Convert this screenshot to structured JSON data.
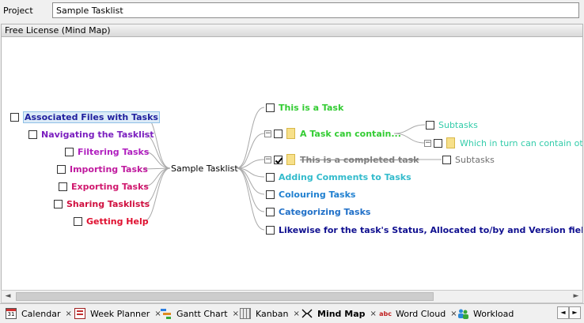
{
  "project": {
    "label": "Project",
    "value": "Sample Tasklist"
  },
  "panel": {
    "title": "Free License (Mind Map)"
  },
  "mindmap": {
    "root": {
      "label": "Sample Tasklist",
      "color": "#000000"
    },
    "left": [
      {
        "label": "Associated Files with Tasks",
        "color": "#1f1f9e",
        "selected": true
      },
      {
        "label": "Navigating the Tasklist",
        "color": "#7b1fbf"
      },
      {
        "label": "Filtering Tasks",
        "color": "#b01fbf"
      },
      {
        "label": "Importing Tasks",
        "color": "#c01a9e"
      },
      {
        "label": "Exporting Tasks",
        "color": "#d0186e"
      },
      {
        "label": "Sharing Tasklists",
        "color": "#d01040"
      },
      {
        "label": "Getting Help",
        "color": "#e01030"
      }
    ],
    "right": [
      {
        "label": "This is a Task",
        "color": "#33cc33"
      },
      {
        "label": "A Task can contain...",
        "color": "#33cc33"
      },
      {
        "label": "This is a completed task",
        "color": "#808080",
        "completed": true
      },
      {
        "label": "Adding Comments to Tasks",
        "color": "#33bbcc"
      },
      {
        "label": "Colouring Tasks",
        "color": "#2080d0"
      },
      {
        "label": "Categorizing Tasks",
        "color": "#2070c8"
      },
      {
        "label": "Likewise for the task's Status, Allocated to/by and Version fields",
        "color": "#101090"
      }
    ],
    "sub": {
      "subtasks_a": {
        "label": "Subtasks",
        "color": "#33ccaa"
      },
      "nested": {
        "label": "Which in turn can contain othe",
        "color": "#33ccaa"
      },
      "subtasks_b": {
        "label": "Subtasks",
        "color": "#707070"
      }
    }
  },
  "tabs": [
    {
      "label": "Calendar",
      "icon": "calendar-icon"
    },
    {
      "label": "Week Planner",
      "icon": "week-planner-icon"
    },
    {
      "label": "Gantt Chart",
      "icon": "gantt-chart-icon"
    },
    {
      "label": "Kanban",
      "icon": "kanban-icon"
    },
    {
      "label": "Mind Map",
      "icon": "mind-map-icon",
      "active": true
    },
    {
      "label": "Word Cloud",
      "icon": "word-cloud-icon"
    },
    {
      "label": "Workload",
      "icon": "workload-icon"
    }
  ],
  "icons": {
    "calendar_day": "31",
    "word_cloud": "abc"
  },
  "close_glyph": "×",
  "nav": {
    "prev": "◄",
    "next": "►"
  }
}
